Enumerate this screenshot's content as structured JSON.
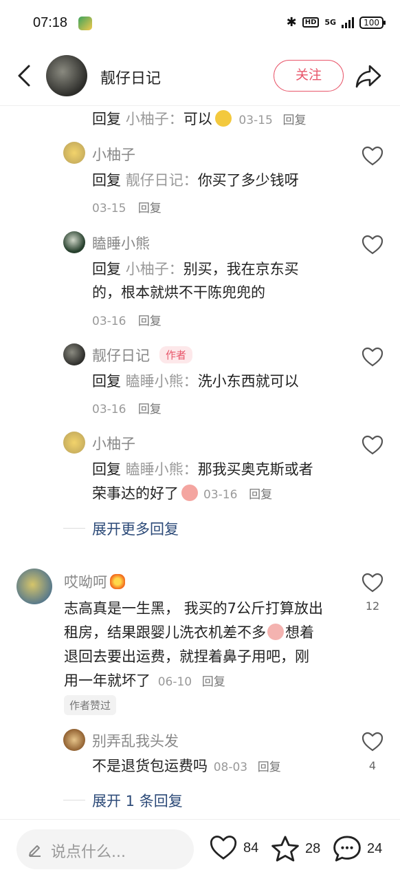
{
  "status_bar": {
    "time": "07:18",
    "hd": "HD",
    "network": "5G",
    "battery": "100",
    "bluetooth_icon": "bluetooth-icon"
  },
  "header": {
    "title": "靓仔日记",
    "follow_label": "关注",
    "back_icon": "back-arrow-icon",
    "share_icon": "share-icon"
  },
  "replies_top": {
    "fragment": {
      "prefix": "回复",
      "target": "小柚子：",
      "text": "可以",
      "date": "03-15",
      "reply": "回复"
    },
    "items": [
      {
        "author": "小柚子",
        "prefix": "回复",
        "target": "靓仔日记：",
        "text": "你买了多少钱呀",
        "date": "03-15",
        "reply": "回复"
      },
      {
        "author": "瞌睡小熊",
        "prefix": "回复",
        "target": "小柚子：",
        "text_line1": "别买，我在京东买",
        "text_line2": "的，根本就烘不干陈兜兜的",
        "date": "03-16",
        "reply": "回复"
      },
      {
        "author": "靓仔日记",
        "badge": "作者",
        "prefix": "回复",
        "target": "瞌睡小熊：",
        "text": "洗小东西就可以",
        "date": "03-16",
        "reply": "回复"
      },
      {
        "author": "小柚子",
        "prefix": "回复",
        "target": "瞌睡小熊：",
        "text_line1": "那我买奥克斯或者",
        "text_line2": "荣事达的好了",
        "date": "03-16",
        "reply": "回复"
      }
    ],
    "expand_more": "展开更多回复"
  },
  "comment": {
    "author": "哎呦呵",
    "like_count": "12",
    "line1": "志高真是一生黑， 我买的7公斤打算放出",
    "line2": "租房，结果跟婴儿洗衣机差不多",
    "line2b": "想着",
    "line3": "退回去要出运费，就捏着鼻子用吧，刚",
    "line4": "用一年就坏了",
    "date": "06-10",
    "reply": "回复",
    "liked_badge": "作者赞过",
    "sub_reply": {
      "author": "别弄乱我头发",
      "text": "不是退货包运费吗",
      "date": "08-03",
      "reply": "回复",
      "like_count": "4"
    },
    "expand": "展开 1 条回复"
  },
  "bottom_bar": {
    "input_placeholder": "说点什么...",
    "likes": "84",
    "stars": "28",
    "comments": "24"
  }
}
